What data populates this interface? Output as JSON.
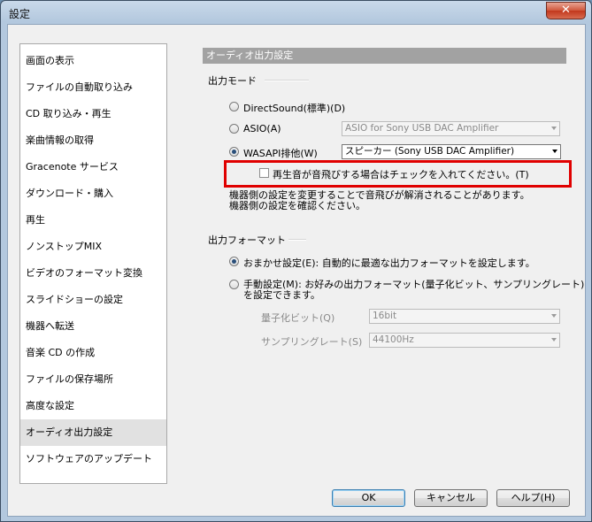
{
  "window": {
    "title": "設定",
    "close_glyph": "✕"
  },
  "sidebar": {
    "items": [
      "画面の表示",
      "ファイルの自動取り込み",
      "CD 取り込み・再生",
      "楽曲情報の取得",
      "Gracenote サービス",
      "ダウンロード・購入",
      "再生",
      "ノンストップMIX",
      "ビデオのフォーマット変換",
      "スライドショーの設定",
      "機器へ転送",
      "音楽 CD の作成",
      "ファイルの保存場所",
      "高度な設定",
      "オーディオ出力設定",
      "ソフトウェアのアップデート"
    ],
    "selected_index": 14
  },
  "panel": {
    "header": "オーディオ出力設定",
    "output_mode": {
      "group_label": "出力モード",
      "directsound_label": "DirectSound(標準)(D)",
      "asio_label": "ASIO(A)",
      "asio_value": "ASIO for Sony USB DAC Amplifier",
      "wasapi_label": "WASAPI排他(W)",
      "wasapi_value": "スピーカー (Sony USB DAC Amplifier)",
      "selected": "wasapi",
      "skip_check_label": "再生音が音飛びする場合はチェックを入れてください。(T)",
      "note_line1": "機器側の設定を変更することで音飛びが解消されることがあります。",
      "note_line2": "機器側の設定を確認ください。"
    },
    "output_format": {
      "group_label": "出力フォーマット",
      "auto_label": "おまかせ設定(E): 自動的に最適な出力フォーマットを設定します。",
      "manual_label_line1": "手動設定(M):  お好みの出力フォーマット(量子化ビット、サンプリングレート)",
      "manual_label_line2": "を設定できます。",
      "selected": "auto",
      "bit_label": "量子化ビット(Q)",
      "bit_value": "16bit",
      "rate_label": "サンプリングレート(S)",
      "rate_value": "44100Hz"
    }
  },
  "buttons": {
    "ok": "OK",
    "cancel": "キャンセル",
    "help": "ヘルプ(H)"
  }
}
